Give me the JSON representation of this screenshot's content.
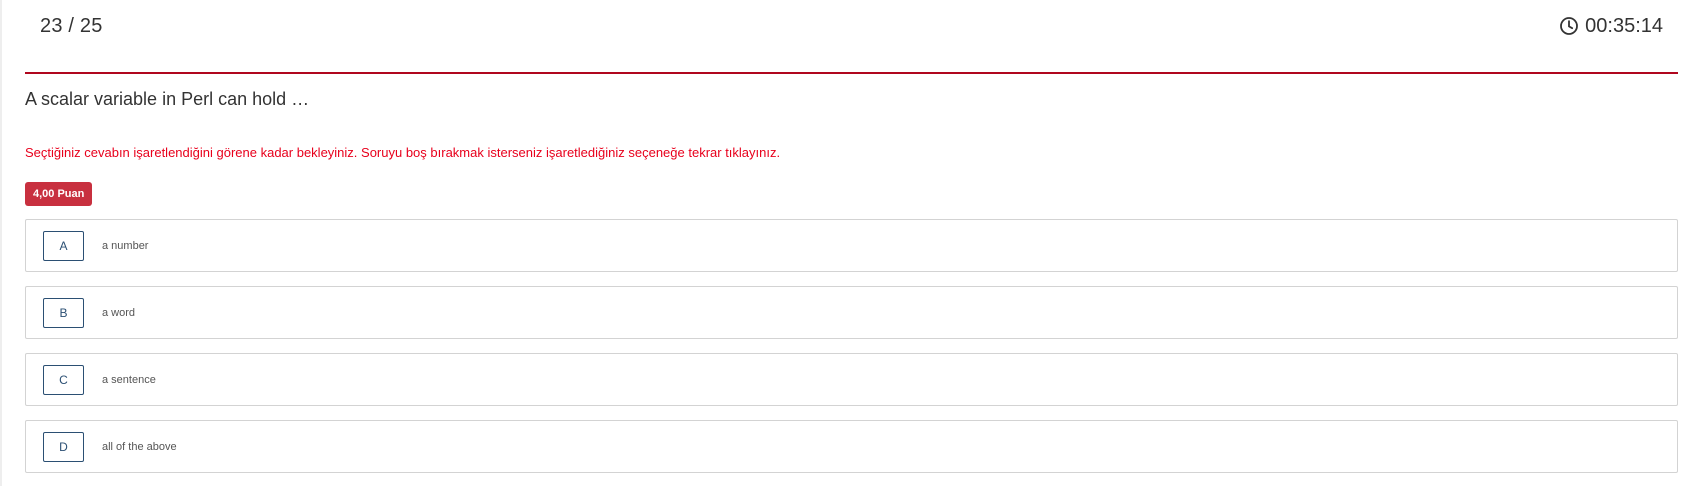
{
  "header": {
    "counter": "23 / 25",
    "timer": "00:35:14",
    "timer_icon": "clock-icon"
  },
  "question": {
    "text": "A scalar variable in Perl can hold …",
    "warning": "Seçtiğiniz cevabın işaretlendiğini görene kadar bekleyiniz. Soruyu boş bırakmak isterseniz işaretlediğiniz seçeneğe tekrar tıklayınız.",
    "points_badge": "4,00 Puan"
  },
  "options": [
    {
      "letter": "A",
      "text": "a number"
    },
    {
      "letter": "B",
      "text": "a word"
    },
    {
      "letter": "C",
      "text": "a sentence"
    },
    {
      "letter": "D",
      "text": "all of the above"
    }
  ],
  "colors": {
    "accent_line": "#b0071e",
    "warning_text": "#e8001c",
    "badge_bg": "#c8303f",
    "option_letter": "#2b4f73"
  }
}
